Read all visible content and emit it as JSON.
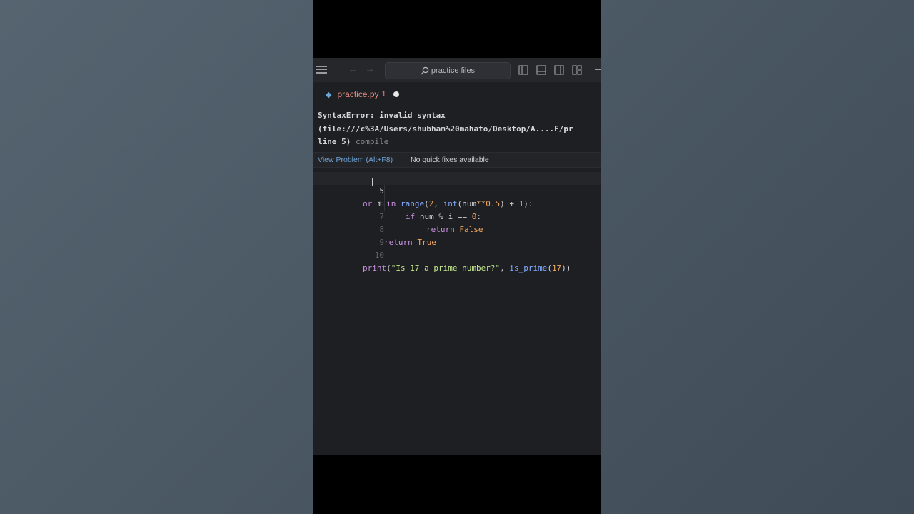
{
  "titlebar": {
    "search_placeholder": "practice files"
  },
  "tab": {
    "filename": "practice.py",
    "problem_count": "1"
  },
  "error": {
    "line1": "SyntaxError: invalid syntax",
    "line2": "(file:///c%3A/Users/shubham%20mahato/Desktop/A....F/pr",
    "line3_main": "line 5)",
    "line3_source": "compile"
  },
  "actions": {
    "view_problem": "View Problem (Alt+F8)",
    "no_fixes": "No quick fixes available"
  },
  "editor": {
    "lines": [
      {
        "n": "5"
      },
      {
        "n": "6"
      },
      {
        "n": "7"
      },
      {
        "n": "8"
      },
      {
        "n": "9"
      },
      {
        "n": "10"
      }
    ],
    "tokens": {
      "l5_a": "or",
      "l5_b": " i ",
      "l5_c": "in",
      "l5_d": " ",
      "l5_e": "range",
      "l5_f": "(",
      "l5_g": "2",
      "l5_h": ", ",
      "l5_i": "int",
      "l5_j": "(num",
      "l5_k": "**",
      "l5_l": "0.5",
      "l5_m": ") + ",
      "l5_n": "1",
      "l5_o": "):",
      "l6_a": "if",
      "l6_b": " num % i == ",
      "l6_c": "0",
      "l6_d": ":",
      "l7_a": "return",
      "l7_b": "False",
      "l8_a": "return",
      "l8_b": "True",
      "l10_a": "print",
      "l10_b": "(",
      "l10_c": "\"Is 17 a prime number?\"",
      "l10_d": ", ",
      "l10_e": "is_prime",
      "l10_f": "(",
      "l10_g": "17",
      "l10_h": "))"
    }
  },
  "colors": {
    "background": "#1e1f22",
    "tab_name": "#e48c80",
    "link": "#6ea3d6",
    "keyword": "#c991e1",
    "function": "#82aaff",
    "number": "#f4a662",
    "string": "#c3e88d"
  }
}
